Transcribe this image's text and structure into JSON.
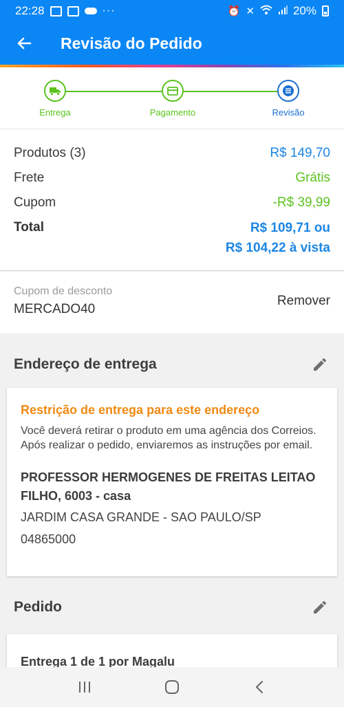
{
  "status_bar": {
    "time": "22:28",
    "dots": "···",
    "battery": "20%"
  },
  "app_bar": {
    "title": "Revisão do Pedido"
  },
  "stepper": {
    "steps": [
      {
        "label": "Entrega",
        "icon": "truck-icon",
        "state": "done"
      },
      {
        "label": "Pagamento",
        "icon": "card-icon",
        "state": "done"
      },
      {
        "label": "Revisão",
        "icon": "list-icon",
        "state": "current"
      }
    ]
  },
  "summary": {
    "products_label": "Produtos (3)",
    "products_value": "R$ 149,70",
    "shipping_label": "Frete",
    "shipping_value": "Grátis",
    "coupon_label": "Cupom",
    "coupon_value": "-R$ 39,99",
    "total_label": "Total",
    "total_value_line1": "R$ 109,71 ou",
    "total_value_line2": "R$ 104,22 à vista"
  },
  "coupon": {
    "label": "Cupom de desconto",
    "code": "MERCADO40",
    "remove_label": "Remover"
  },
  "address_section": {
    "title": "Endereço de entrega",
    "warning_title": "Restrição de entrega para este endereço",
    "warning_text": "Você deverá retirar o produto em uma agência dos Correios. Após realizar o pedido, enviaremos as instruções por email.",
    "street": "PROFESSOR HERMOGENES DE FREITAS LEITAO FILHO, 6003 - casa",
    "district": "JARDIM CASA GRANDE - SAO PAULO/SP",
    "zip": "04865000"
  },
  "order_section": {
    "title": "Pedido",
    "delivery_line": "Entrega 1 de 1 por Magalu"
  },
  "colors": {
    "primary": "#0a86f5",
    "success": "#5bc21e",
    "warning": "#f08a12",
    "price": "#1c86e3"
  }
}
